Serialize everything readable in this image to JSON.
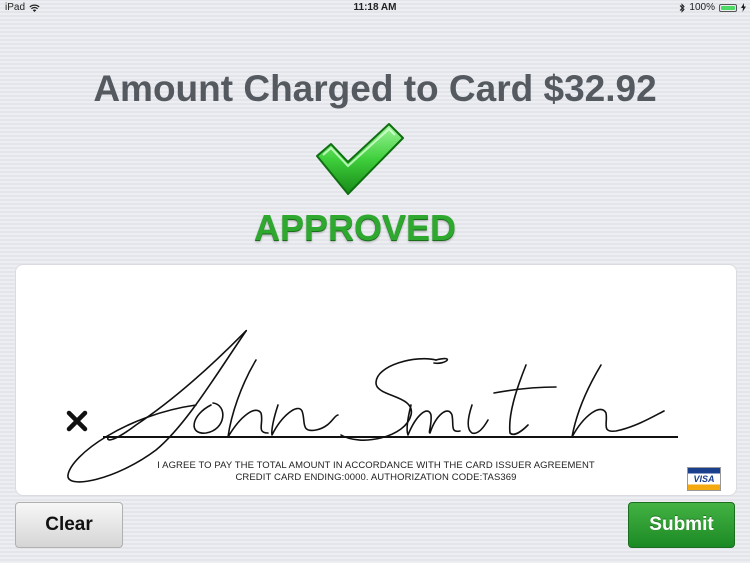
{
  "status_bar": {
    "device": "iPad",
    "wifi_icon": "wifi-icon",
    "time": "11:18 AM",
    "bluetooth_icon": "bluetooth-icon",
    "battery": "100%",
    "battery_level": 1.0
  },
  "payment": {
    "amount_label": "Amount Charged to Card $32.92",
    "status_icon": "checkmark-icon",
    "status": "APPROVED",
    "status_color": "#2ea82e"
  },
  "signature": {
    "signer_name": "John Smith",
    "mark_icon": "x-mark-icon",
    "agreement_line1": "I AGREE TO PAY THE TOTAL AMOUNT IN ACCORDANCE WITH THE CARD ISSUER AGREEMENT",
    "agreement_line2": "CREDIT CARD ENDING:0000.  AUTHORIZATION CODE:TAS369",
    "card_brand": "VISA"
  },
  "actions": {
    "clear_label": "Clear",
    "submit_label": "Submit",
    "submit_color": "#2a9a2e"
  }
}
